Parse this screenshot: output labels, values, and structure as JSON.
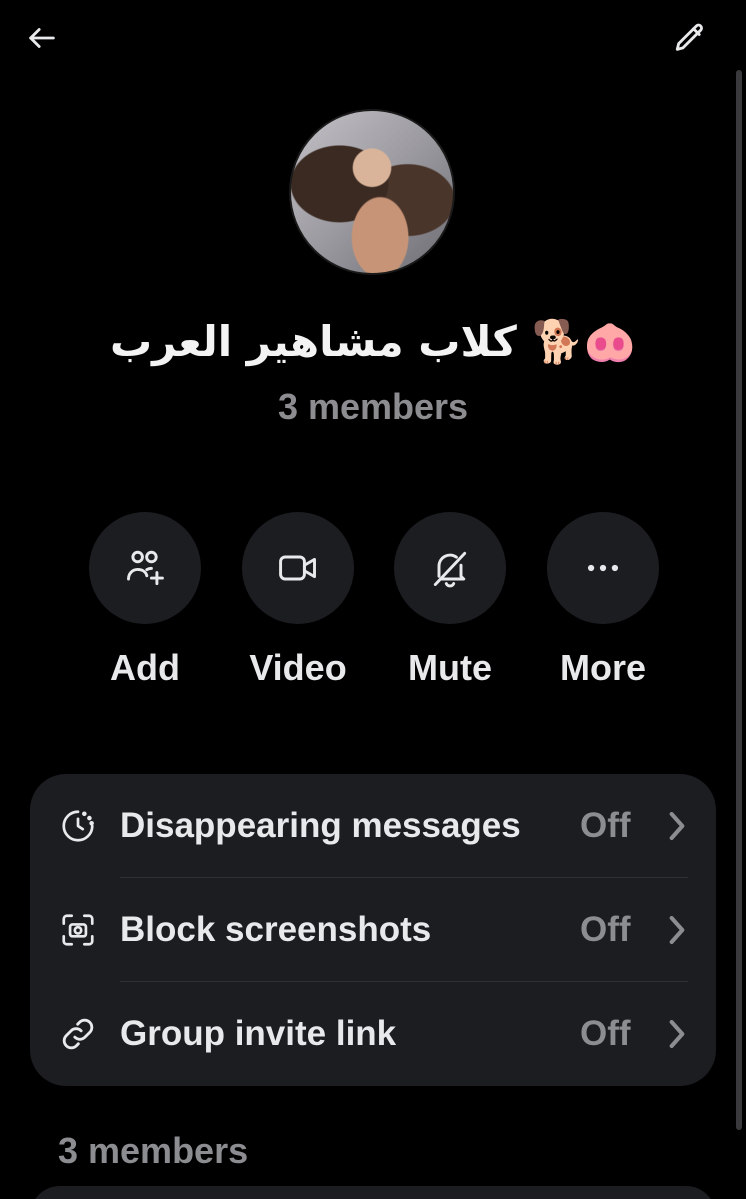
{
  "header": {
    "back_icon": "arrow-left-icon",
    "edit_icon": "pencil-icon"
  },
  "group": {
    "name": "كلاب مشاهير العرب 🐕🐽",
    "member_count": "3 members",
    "avatar": "group-avatar-photo"
  },
  "actions": [
    {
      "label": "Add",
      "icon": "add-people-icon"
    },
    {
      "label": "Video",
      "icon": "video-camera-icon"
    },
    {
      "label": "Mute",
      "icon": "bell-off-icon"
    },
    {
      "label": "More",
      "icon": "more-dots-icon"
    }
  ],
  "settings": [
    {
      "label": "Disappearing messages",
      "value": "Off",
      "icon": "timer-icon"
    },
    {
      "label": "Block screenshots",
      "value": "Off",
      "icon": "screenshot-icon"
    },
    {
      "label": "Group invite link",
      "value": "Off",
      "icon": "link-icon"
    }
  ],
  "members_section": {
    "heading": "3 members"
  },
  "colors": {
    "background": "#000000",
    "card": "#1c1d21",
    "text_primary": "#e7e9ea",
    "text_secondary": "#8b8d91"
  }
}
